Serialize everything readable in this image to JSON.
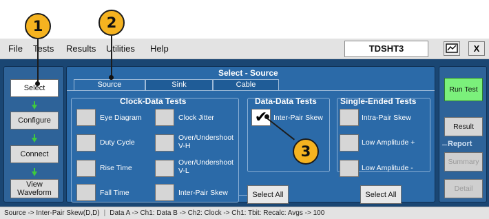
{
  "callouts": [
    "1",
    "2",
    "3"
  ],
  "menubar": {
    "items": [
      "File",
      "Tests",
      "Results",
      "Utilities",
      "Help"
    ],
    "app_title": "TDSHT3",
    "minimize_icon": "window-icon",
    "close_label": "X"
  },
  "nav": {
    "items": [
      "Select",
      "Configure",
      "Connect",
      "View Waveform"
    ],
    "active": "Select",
    "arrow_color": "#3ec93e"
  },
  "panel": {
    "title": "Select - Source",
    "tabs": [
      "Source",
      "Sink",
      "Cable"
    ],
    "active_tab": "Source"
  },
  "clock_data": {
    "title": "Clock-Data Tests",
    "tests": [
      "Eye Diagram",
      "Clock Jitter",
      "Duty Cycle",
      "Over/Undershoot V-H",
      "Rise Time",
      "Over/Undershoot V-L",
      "Fall Time",
      "Inter-Pair Skew"
    ]
  },
  "data_data": {
    "title": "Data-Data Tests",
    "tests": [
      "Inter-Pair Skew"
    ],
    "checked": true
  },
  "single_ended": {
    "title": "Single-Ended Tests",
    "tests": [
      "Intra-Pair Skew",
      "Low Amplitude +",
      "Low Amplitude -"
    ]
  },
  "buttons": {
    "select_all_1": "Select All",
    "select_all_2": "Select All"
  },
  "right": {
    "run_test": "Run Test",
    "result": "Result",
    "report": "Report",
    "summary": "Summary",
    "detail": "Detail"
  },
  "status": {
    "left": "Source -> Inter-Pair Skew(D,D)",
    "right": "Data A -> Ch1: Data B -> Ch2: Clock -> Ch1: Tbit: Recalc: Avgs -> 100"
  },
  "colors": {
    "callout": "#f5b320",
    "background_main": "#1a4673",
    "panel_blue": "#2b6aa8",
    "run_green": "#7bf07b"
  }
}
